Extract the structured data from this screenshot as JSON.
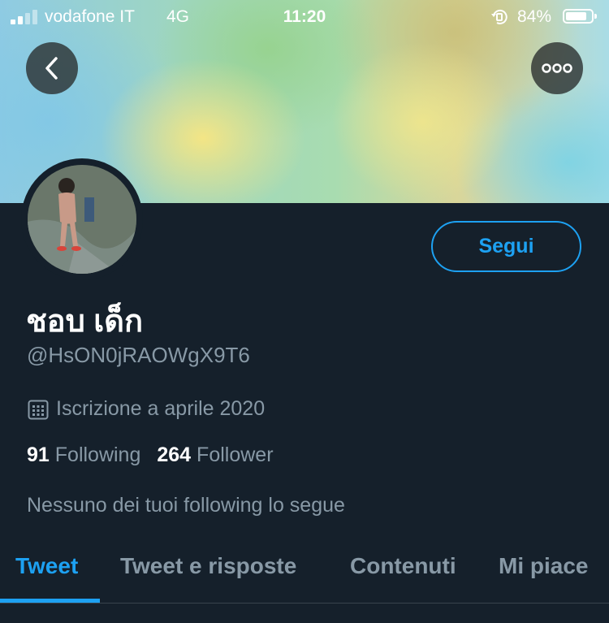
{
  "status_bar": {
    "carrier": "vodafone IT",
    "network": "4G",
    "time": "11:20",
    "battery": "84%",
    "battery_level": 0.84
  },
  "profile": {
    "display_name": "ชอบ เด็ก",
    "handle": "@HsON0jRAOWgX9T6",
    "joined": "Iscrizione a aprile 2020",
    "following_count": "91",
    "following_label": "Following",
    "follower_count": "264",
    "follower_label": "Follower",
    "mutuals": "Nessuno dei tuoi following lo segue"
  },
  "actions": {
    "follow_label": "Segui",
    "back_icon": "chevron-left-icon",
    "more_icon": "more-horizontal-icon"
  },
  "tabs": [
    {
      "label": "Tweet",
      "active": true
    },
    {
      "label": "Tweet e risposte",
      "active": false
    },
    {
      "label": "Contenuti",
      "active": false
    },
    {
      "label": "Mi piace",
      "active": false
    }
  ],
  "colors": {
    "background": "#15202b",
    "accent": "#1da1f2",
    "secondary_text": "#8899a6"
  }
}
